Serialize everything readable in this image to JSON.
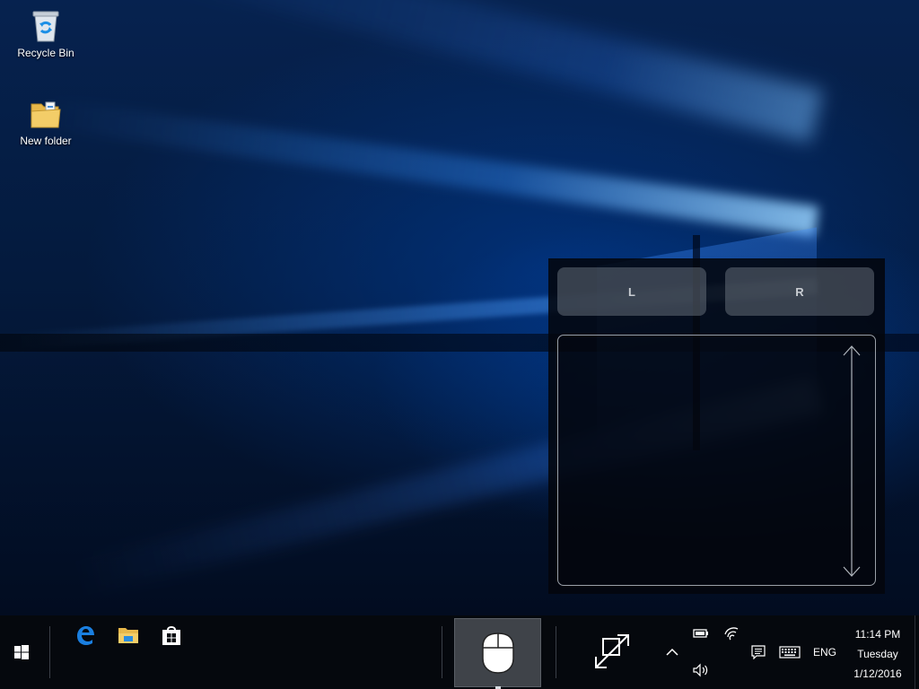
{
  "desktop": {
    "icons": [
      {
        "label": "Recycle Bin",
        "icon": "recycle-bin-icon"
      },
      {
        "label": "New folder",
        "icon": "folder-icon"
      }
    ]
  },
  "touchpad": {
    "left_button": "L",
    "right_button": "R"
  },
  "taskbar": {
    "pinned": [
      "edge-icon",
      "file-explorer-icon",
      "store-icon"
    ],
    "tray": {
      "language": "ENG"
    },
    "clock": {
      "time": "11:14 PM",
      "day": "Tuesday",
      "date": "1/12/2016"
    }
  },
  "colors": {
    "accent": "#1a7fe0",
    "taskbar": "#05080d",
    "active_button": "#3f4349"
  }
}
